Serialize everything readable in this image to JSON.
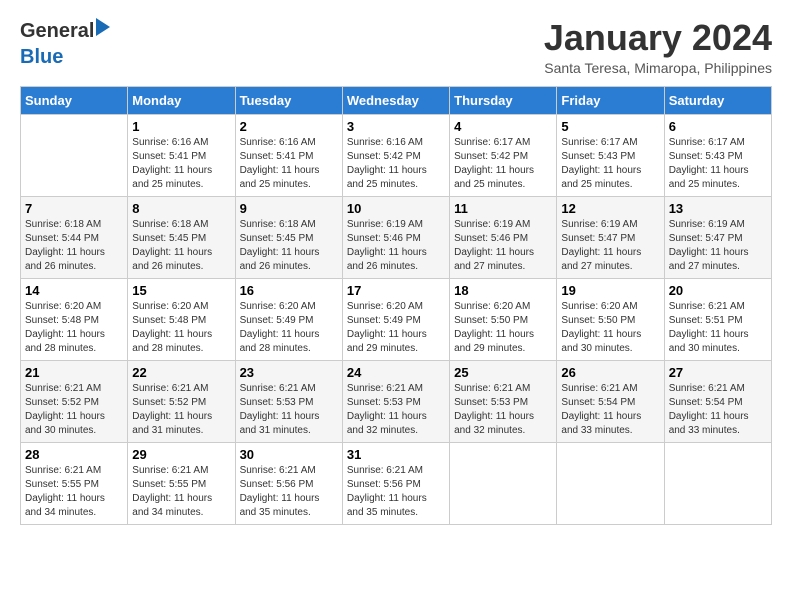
{
  "header": {
    "logo_line1": "General",
    "logo_line2": "Blue",
    "month_title": "January 2024",
    "subtitle": "Santa Teresa, Mimaropa, Philippines"
  },
  "days_of_week": [
    "Sunday",
    "Monday",
    "Tuesday",
    "Wednesday",
    "Thursday",
    "Friday",
    "Saturday"
  ],
  "weeks": [
    [
      {
        "day": "",
        "sunrise": "",
        "sunset": "",
        "daylight": ""
      },
      {
        "day": "1",
        "sunrise": "Sunrise: 6:16 AM",
        "sunset": "Sunset: 5:41 PM",
        "daylight": "Daylight: 11 hours and 25 minutes."
      },
      {
        "day": "2",
        "sunrise": "Sunrise: 6:16 AM",
        "sunset": "Sunset: 5:41 PM",
        "daylight": "Daylight: 11 hours and 25 minutes."
      },
      {
        "day": "3",
        "sunrise": "Sunrise: 6:16 AM",
        "sunset": "Sunset: 5:42 PM",
        "daylight": "Daylight: 11 hours and 25 minutes."
      },
      {
        "day": "4",
        "sunrise": "Sunrise: 6:17 AM",
        "sunset": "Sunset: 5:42 PM",
        "daylight": "Daylight: 11 hours and 25 minutes."
      },
      {
        "day": "5",
        "sunrise": "Sunrise: 6:17 AM",
        "sunset": "Sunset: 5:43 PM",
        "daylight": "Daylight: 11 hours and 25 minutes."
      },
      {
        "day": "6",
        "sunrise": "Sunrise: 6:17 AM",
        "sunset": "Sunset: 5:43 PM",
        "daylight": "Daylight: 11 hours and 25 minutes."
      }
    ],
    [
      {
        "day": "7",
        "sunrise": "Sunrise: 6:18 AM",
        "sunset": "Sunset: 5:44 PM",
        "daylight": "Daylight: 11 hours and 26 minutes."
      },
      {
        "day": "8",
        "sunrise": "Sunrise: 6:18 AM",
        "sunset": "Sunset: 5:45 PM",
        "daylight": "Daylight: 11 hours and 26 minutes."
      },
      {
        "day": "9",
        "sunrise": "Sunrise: 6:18 AM",
        "sunset": "Sunset: 5:45 PM",
        "daylight": "Daylight: 11 hours and 26 minutes."
      },
      {
        "day": "10",
        "sunrise": "Sunrise: 6:19 AM",
        "sunset": "Sunset: 5:46 PM",
        "daylight": "Daylight: 11 hours and 26 minutes."
      },
      {
        "day": "11",
        "sunrise": "Sunrise: 6:19 AM",
        "sunset": "Sunset: 5:46 PM",
        "daylight": "Daylight: 11 hours and 27 minutes."
      },
      {
        "day": "12",
        "sunrise": "Sunrise: 6:19 AM",
        "sunset": "Sunset: 5:47 PM",
        "daylight": "Daylight: 11 hours and 27 minutes."
      },
      {
        "day": "13",
        "sunrise": "Sunrise: 6:19 AM",
        "sunset": "Sunset: 5:47 PM",
        "daylight": "Daylight: 11 hours and 27 minutes."
      }
    ],
    [
      {
        "day": "14",
        "sunrise": "Sunrise: 6:20 AM",
        "sunset": "Sunset: 5:48 PM",
        "daylight": "Daylight: 11 hours and 28 minutes."
      },
      {
        "day": "15",
        "sunrise": "Sunrise: 6:20 AM",
        "sunset": "Sunset: 5:48 PM",
        "daylight": "Daylight: 11 hours and 28 minutes."
      },
      {
        "day": "16",
        "sunrise": "Sunrise: 6:20 AM",
        "sunset": "Sunset: 5:49 PM",
        "daylight": "Daylight: 11 hours and 28 minutes."
      },
      {
        "day": "17",
        "sunrise": "Sunrise: 6:20 AM",
        "sunset": "Sunset: 5:49 PM",
        "daylight": "Daylight: 11 hours and 29 minutes."
      },
      {
        "day": "18",
        "sunrise": "Sunrise: 6:20 AM",
        "sunset": "Sunset: 5:50 PM",
        "daylight": "Daylight: 11 hours and 29 minutes."
      },
      {
        "day": "19",
        "sunrise": "Sunrise: 6:20 AM",
        "sunset": "Sunset: 5:50 PM",
        "daylight": "Daylight: 11 hours and 30 minutes."
      },
      {
        "day": "20",
        "sunrise": "Sunrise: 6:21 AM",
        "sunset": "Sunset: 5:51 PM",
        "daylight": "Daylight: 11 hours and 30 minutes."
      }
    ],
    [
      {
        "day": "21",
        "sunrise": "Sunrise: 6:21 AM",
        "sunset": "Sunset: 5:52 PM",
        "daylight": "Daylight: 11 hours and 30 minutes."
      },
      {
        "day": "22",
        "sunrise": "Sunrise: 6:21 AM",
        "sunset": "Sunset: 5:52 PM",
        "daylight": "Daylight: 11 hours and 31 minutes."
      },
      {
        "day": "23",
        "sunrise": "Sunrise: 6:21 AM",
        "sunset": "Sunset: 5:53 PM",
        "daylight": "Daylight: 11 hours and 31 minutes."
      },
      {
        "day": "24",
        "sunrise": "Sunrise: 6:21 AM",
        "sunset": "Sunset: 5:53 PM",
        "daylight": "Daylight: 11 hours and 32 minutes."
      },
      {
        "day": "25",
        "sunrise": "Sunrise: 6:21 AM",
        "sunset": "Sunset: 5:53 PM",
        "daylight": "Daylight: 11 hours and 32 minutes."
      },
      {
        "day": "26",
        "sunrise": "Sunrise: 6:21 AM",
        "sunset": "Sunset: 5:54 PM",
        "daylight": "Daylight: 11 hours and 33 minutes."
      },
      {
        "day": "27",
        "sunrise": "Sunrise: 6:21 AM",
        "sunset": "Sunset: 5:54 PM",
        "daylight": "Daylight: 11 hours and 33 minutes."
      }
    ],
    [
      {
        "day": "28",
        "sunrise": "Sunrise: 6:21 AM",
        "sunset": "Sunset: 5:55 PM",
        "daylight": "Daylight: 11 hours and 34 minutes."
      },
      {
        "day": "29",
        "sunrise": "Sunrise: 6:21 AM",
        "sunset": "Sunset: 5:55 PM",
        "daylight": "Daylight: 11 hours and 34 minutes."
      },
      {
        "day": "30",
        "sunrise": "Sunrise: 6:21 AM",
        "sunset": "Sunset: 5:56 PM",
        "daylight": "Daylight: 11 hours and 35 minutes."
      },
      {
        "day": "31",
        "sunrise": "Sunrise: 6:21 AM",
        "sunset": "Sunset: 5:56 PM",
        "daylight": "Daylight: 11 hours and 35 minutes."
      },
      {
        "day": "",
        "sunrise": "",
        "sunset": "",
        "daylight": ""
      },
      {
        "day": "",
        "sunrise": "",
        "sunset": "",
        "daylight": ""
      },
      {
        "day": "",
        "sunrise": "",
        "sunset": "",
        "daylight": ""
      }
    ]
  ]
}
